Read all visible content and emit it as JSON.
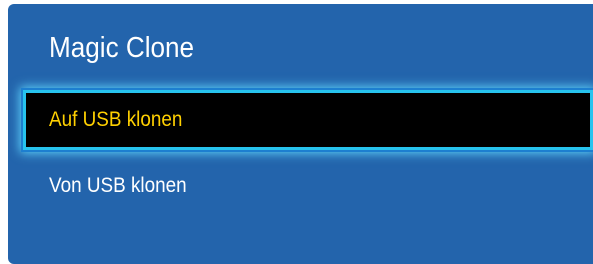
{
  "dialog": {
    "title": "Magic Clone",
    "items": [
      {
        "label": "Auf USB klonen",
        "selected": true
      },
      {
        "label": "Von USB klonen",
        "selected": false
      }
    ]
  },
  "colors": {
    "panel_background": "#2364ac",
    "selected_background": "#000000",
    "selected_text": "#ffd000",
    "selected_border": "#27c3ee",
    "text": "#ffffff"
  }
}
